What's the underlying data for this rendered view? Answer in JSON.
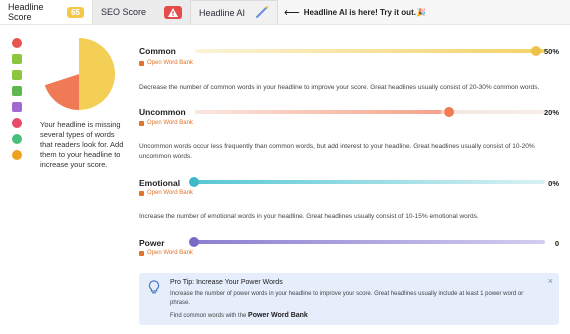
{
  "tabs": {
    "headline_score": {
      "label": "Headline Score",
      "score": "65"
    },
    "seo_score": {
      "label": "SEO Score"
    },
    "headline_ai": {
      "label": "Headline AI"
    },
    "promo": "Headline AI is here! Try it out.",
    "promo_emoji": "🎉"
  },
  "sidebar_icons": [
    "pie-chart-icon",
    "list-icon",
    "text-icon",
    "sitemap-icon",
    "book-icon",
    "smile-icon",
    "target-icon",
    "search-icon"
  ],
  "summary": "Your headline is missing several types of words that readers look for. Add them to your headline to increase your score.",
  "word_bank_label": "Open Word Bank",
  "metrics": [
    {
      "label": "Common",
      "value": "50%",
      "fraction": 0.5,
      "color": "#f0cf5a",
      "description": "Decrease the number of common words in your headline to improve your score. Great headlines usually consist of 20-30% common words."
    },
    {
      "label": "Uncommon",
      "value": "20%",
      "fraction": 0.2,
      "color": "#f08a6a",
      "description": "Uncommon words occur less frequently than common words, but add interest to your headline. Great headlines usually consist of 10-20% uncommon words."
    },
    {
      "label": "Emotional",
      "value": "0%",
      "fraction": 0,
      "color": "#58c8d4",
      "description": "Increase the number of emotional words in your headline. Great headlines usually consist of 10-15% emotional words."
    },
    {
      "label": "Power",
      "value": "0",
      "fraction": 0,
      "color": "#9b8fd6",
      "description": ""
    }
  ],
  "pro_tip": {
    "title": "Pro Tip: Increase Your Power Words",
    "body": "Increase the number of power words in your headline to improve your score. Great headlines usually include at least 1 power word or phrase.",
    "foot_prefix": "Find common words with the",
    "foot_link": "Power Word Bank",
    "close": "×"
  },
  "chart_data": {
    "type": "pie",
    "categories": [
      "Common",
      "Uncommon",
      "Other"
    ],
    "values": [
      50,
      20,
      30
    ],
    "colors": [
      "#f3cf55",
      "#f07a55",
      "#ffffff"
    ]
  }
}
